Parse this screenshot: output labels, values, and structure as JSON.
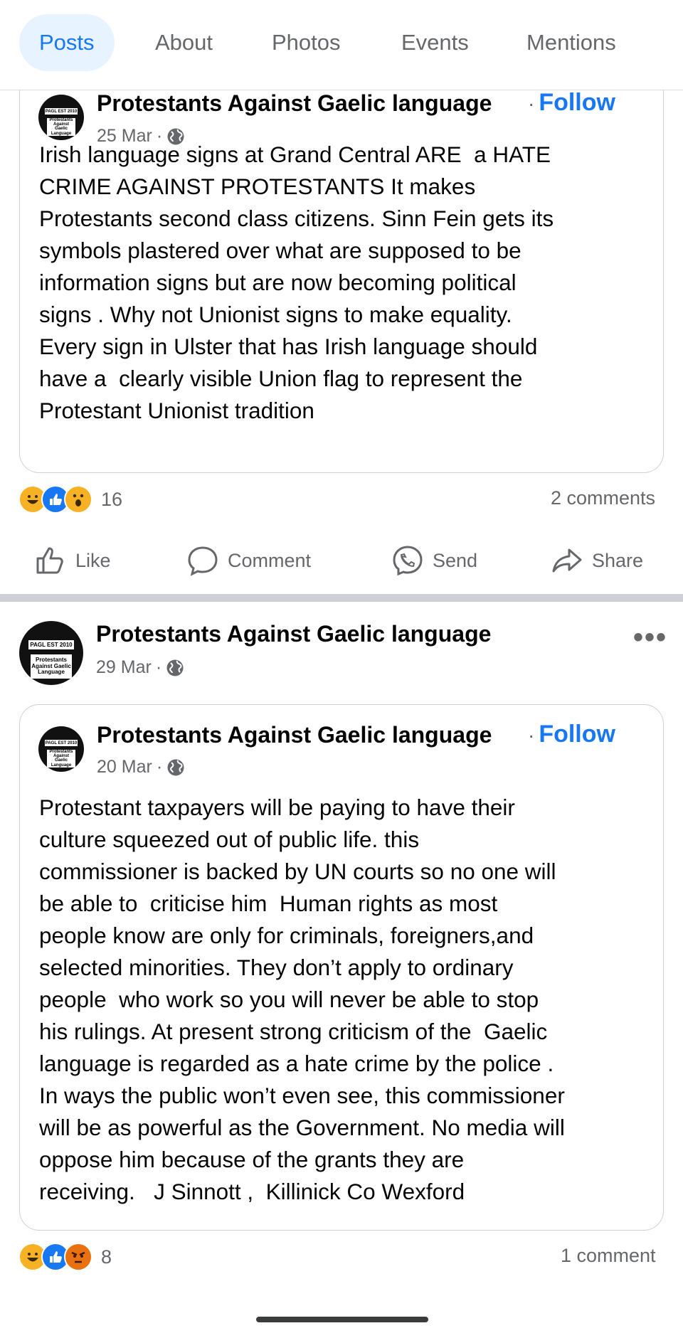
{
  "tabs": [
    {
      "label": "Posts"
    },
    {
      "label": "About"
    },
    {
      "label": "Photos"
    },
    {
      "label": "Events"
    },
    {
      "label": "Mentions"
    }
  ],
  "avatar": {
    "tag": "PAGL EST 2010",
    "lines": [
      "Protestants",
      "Against Gaelic",
      "Language"
    ]
  },
  "post1": {
    "shared": {
      "author": "Protestants Against Gaelic language",
      "follow": "Follow",
      "date": "25 Mar",
      "body": "Irish language signs at Grand Central ARE  a HATE\nCRIME AGAINST PROTESTANTS It makes\nProtestants second class citizens. Sinn Fein gets its\nsymbols plastered over what are supposed to be\ninformation signs but are now becoming political\nsigns . Why not Unionist signs to make equality.\nEvery sign in Ulster that has Irish language should\nhave a  clearly visible Union flag to represent the\nProtestant Unionist tradition"
    },
    "reaction_count": "16",
    "comments": "2 comments",
    "actions": {
      "like": "Like",
      "comment": "Comment",
      "send": "Send",
      "share": "Share"
    }
  },
  "post2": {
    "author": "Protestants Against Gaelic language",
    "date": "29 Mar",
    "shared": {
      "author": "Protestants Against Gaelic language",
      "follow": "Follow",
      "date": "20 Mar",
      "body": "Protestant taxpayers will be paying to have their\nculture squeezed out of public life. this\ncommissioner is backed by UN courts so no one will\nbe able to  criticise him  Human rights as most\npeople know are only for criminals, foreigners,and\nselected minorities. They don’t apply to ordinary\npeople  who work so you will never be able to stop\nhis rulings. At present strong criticism of the  Gaelic\nlanguage is regarded as a hate crime by the police .\nIn ways the public won’t even see, this commissioner\nwill be as powerful as the Government. No media will\noppose him because of the grants they are\nreceiving.   J Sinnott ,  Killinick Co Wexford"
    },
    "reaction_count": "8",
    "comments": "1 comment"
  }
}
